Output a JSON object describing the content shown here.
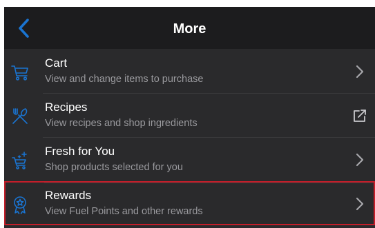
{
  "header": {
    "title": "More",
    "back_icon": "chevron-left-icon"
  },
  "colors": {
    "accent_blue": "#1a74d1",
    "header_bg": "#1c1c1e",
    "list_bg": "#2a2a2c",
    "highlight_border": "#c41e2a",
    "subtitle": "#9a9a9e"
  },
  "menu": {
    "items": [
      {
        "title": "Cart",
        "subtitle": "View and change items to purchase",
        "icon": "cart-icon",
        "trailing_icon": "chevron-right-icon"
      },
      {
        "title": "Recipes",
        "subtitle": "View recipes and shop ingredients",
        "icon": "recipes-utensils-icon",
        "trailing_icon": "external-link-icon"
      },
      {
        "title": "Fresh for You",
        "subtitle": "Shop products selected for you",
        "icon": "sparkle-cart-icon",
        "trailing_icon": "chevron-right-icon"
      },
      {
        "title": "Rewards",
        "subtitle": "View Fuel Points and other rewards",
        "icon": "rewards-ribbon-icon",
        "trailing_icon": "chevron-right-icon",
        "highlighted": true
      }
    ]
  }
}
